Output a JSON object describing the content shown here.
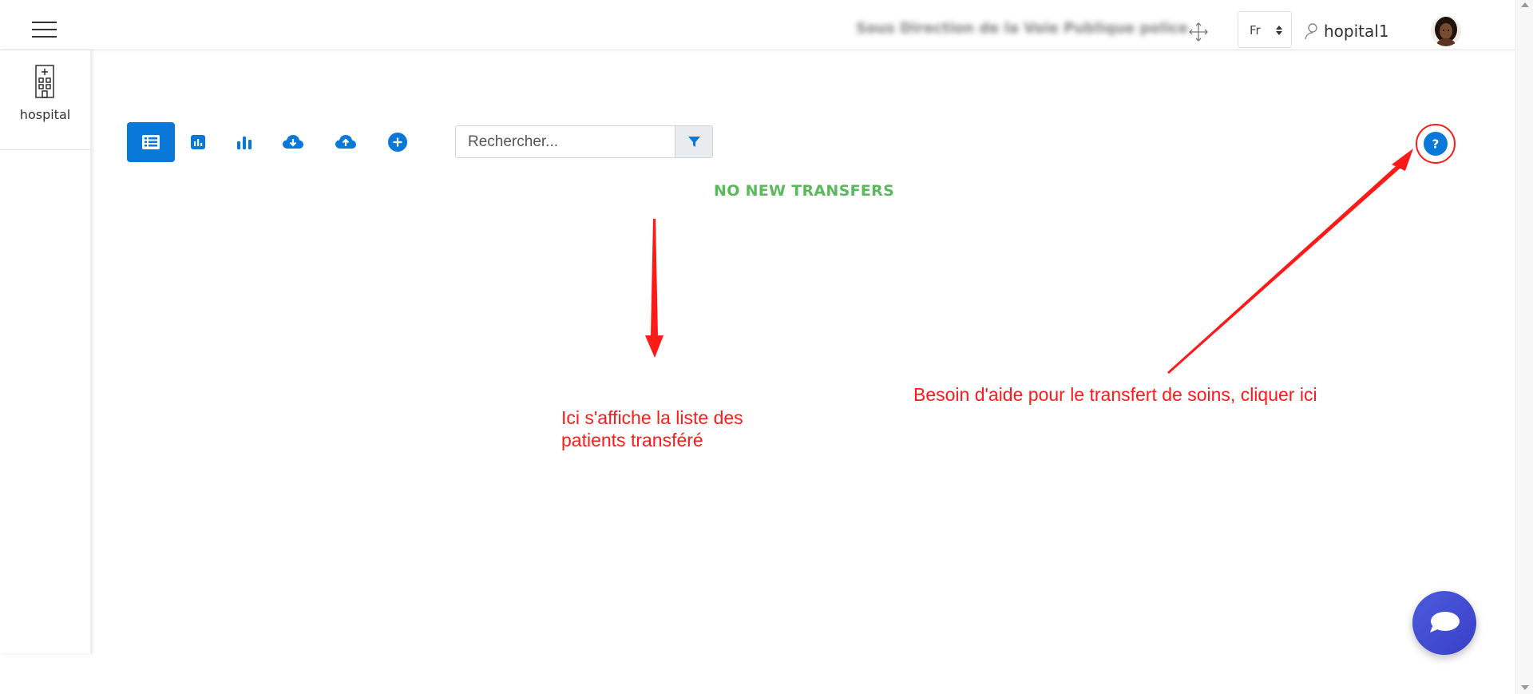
{
  "header": {
    "org_name": "Sous Direction de la Voie Publique police",
    "language": "Fr",
    "username": "hopital1"
  },
  "sidebar": {
    "items": [
      {
        "label": "hospital",
        "icon": "hospital-icon"
      }
    ]
  },
  "toolbar": {
    "buttons": [
      {
        "icon": "list-icon",
        "active": true
      },
      {
        "icon": "chart-box-icon",
        "active": false
      },
      {
        "icon": "bar-chart-icon",
        "active": false
      },
      {
        "icon": "cloud-download-icon",
        "active": false
      },
      {
        "icon": "cloud-upload-icon",
        "active": false
      },
      {
        "icon": "plus-circle-icon",
        "active": false
      }
    ]
  },
  "search": {
    "placeholder": "Rechercher...",
    "value": "",
    "filter_icon": "filter-icon"
  },
  "main": {
    "status": "NO NEW TRANSFERS"
  },
  "help": {
    "icon": "help-icon",
    "symbol": "?"
  },
  "annotations": {
    "list_note_line1": "Ici s'affiche la liste des",
    "list_note_line2": "patients transféré",
    "help_note": "Besoin d'aide pour le transfert de soins, cliquer ici",
    "color": "#ff1a1a"
  },
  "chat": {
    "icon": "chat-bubble-icon"
  },
  "colors": {
    "accent": "#0a78d8",
    "status_green": "#5cb85c",
    "chat_bg": "#3f48d0"
  }
}
